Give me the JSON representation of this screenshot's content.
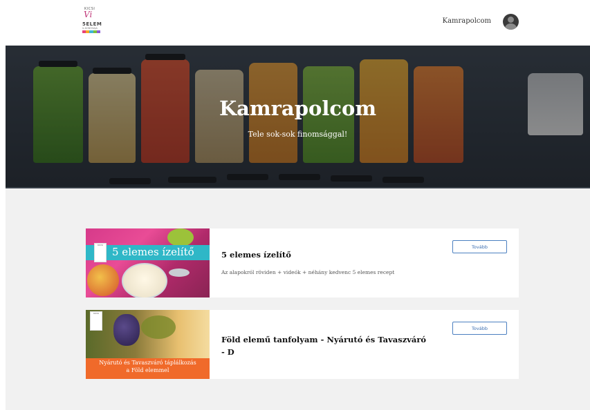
{
  "header": {
    "logo": {
      "line1": "KICSI",
      "line2": "Vi",
      "line3": "5ELEM",
      "line4": "& KONYHAJA",
      "stripe_colors": [
        "#e8417a",
        "#f5a623",
        "#3fb5d6",
        "#7cbf3a",
        "#8a5bd6"
      ]
    },
    "user_name": "Kamrapolcom"
  },
  "hero": {
    "title": "Kamrapolcom",
    "subtitle": "Tele sok-sok finomsággal!"
  },
  "courses": [
    {
      "title": "5 elemes ízelítő",
      "description": "Az alapokról röviden + videók + néhány kedvenc 5 elemes recept",
      "button_label": "Tovább",
      "image_text": "5 elemes ízelítő"
    },
    {
      "title_line1": "Föld elemű tanfolyam - Nyárutó és Tavaszváró",
      "title_line2": "- D",
      "description": "",
      "button_label": "Tovább",
      "image_text_line1": "Nyárutó és Tavaszváró táplálkozás",
      "image_text_line2": "a Föld elemmel"
    }
  ],
  "colors": {
    "accent_blue": "#4a7fc0",
    "ribbon_teal": "#2fb7c7",
    "banner_orange": "#f06a2a",
    "page_bg": "#f1f1f1"
  }
}
